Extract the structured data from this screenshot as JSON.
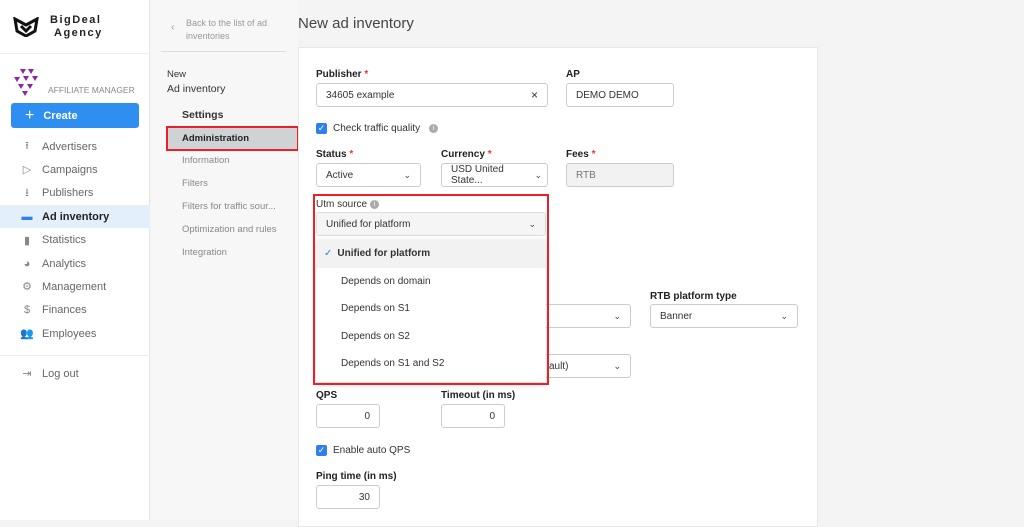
{
  "brand": {
    "line1": "BigDeal",
    "line2": "Agency"
  },
  "role": "AFFILIATE MANAGER",
  "create_label": "Create",
  "nav": [
    {
      "label": "Advertisers",
      "icon": "upload-icon"
    },
    {
      "label": "Campaigns",
      "icon": "play-circle-icon"
    },
    {
      "label": "Publishers",
      "icon": "download-icon"
    },
    {
      "label": "Ad inventory",
      "icon": "ad-inventory-icon",
      "active": true
    },
    {
      "label": "Statistics",
      "icon": "bar-chart-icon"
    },
    {
      "label": "Analytics",
      "icon": "pie-chart-icon"
    },
    {
      "label": "Management",
      "icon": "gear-box-icon"
    },
    {
      "label": "Finances",
      "icon": "dollar-icon"
    },
    {
      "label": "Employees",
      "icon": "people-icon"
    }
  ],
  "logout": "Log out",
  "sub": {
    "back": "Back to the list of ad inventories",
    "new": "New",
    "entity": "Ad inventory",
    "section": "Settings",
    "items": [
      "Administration",
      "Information",
      "Filters",
      "Filters for traffic sour...",
      "Optimization and rules",
      "Integration"
    ]
  },
  "page_title": "New ad inventory",
  "form": {
    "publisher_label": "Publisher",
    "publisher_value": "34605 example",
    "ap_label": "AP",
    "ap_value": "DEMO DEMO",
    "check_traffic": "Check traffic quality",
    "status_label": "Status",
    "status_value": "Active",
    "currency_label": "Currency",
    "currency_value": "USD United State...",
    "fees_label": "Fees",
    "fees_value": "RTB",
    "utm_label": "Utm source",
    "utm_value": "Unified for platform",
    "utm_options": [
      "Unified for platform",
      "Depends on domain",
      "Depends on S1",
      "Depends on S2",
      "Depends on S1 and S2"
    ],
    "rtb_type_label": "RTB platform type",
    "rtb_type_value": "Banner",
    "hidden_select_value": "ault)",
    "qps_label": "QPS",
    "qps_value": "0",
    "timeout_label": "Timeout (in ms)",
    "timeout_value": "0",
    "auto_qps": "Enable auto QPS",
    "ping_label": "Ping time (in ms)",
    "ping_value": "30"
  },
  "colors": {
    "accent": "#2f80ed",
    "highlight": "#e8202a"
  }
}
